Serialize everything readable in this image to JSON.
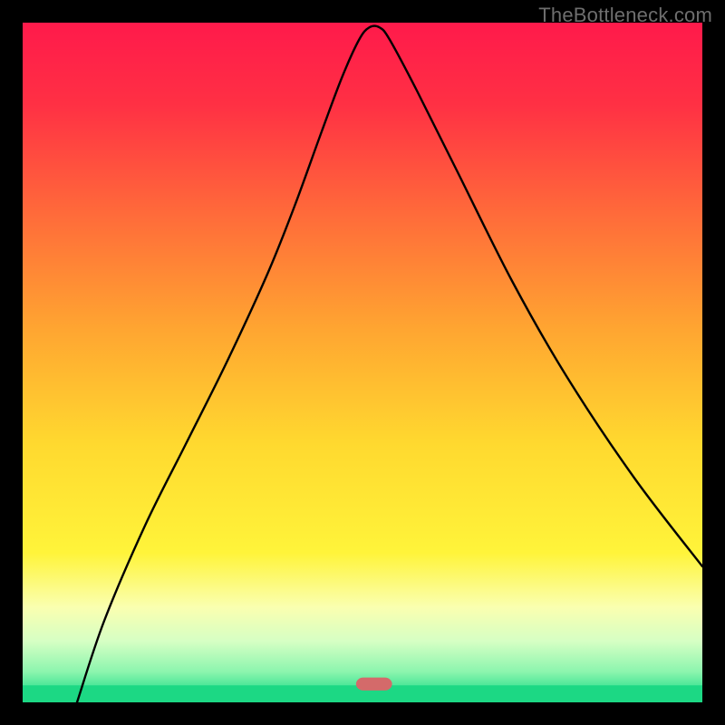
{
  "watermark": "TheBottleneck.com",
  "chart_data": {
    "type": "line",
    "title": "",
    "xlabel": "",
    "ylabel": "",
    "xlim": [
      0,
      100
    ],
    "ylim": [
      0,
      100
    ],
    "background_gradient_stops": [
      {
        "offset": 0.0,
        "color": "#ff1a4b"
      },
      {
        "offset": 0.12,
        "color": "#ff3044"
      },
      {
        "offset": 0.28,
        "color": "#ff6a3a"
      },
      {
        "offset": 0.45,
        "color": "#ffa531"
      },
      {
        "offset": 0.62,
        "color": "#ffd92f"
      },
      {
        "offset": 0.78,
        "color": "#fff43a"
      },
      {
        "offset": 0.86,
        "color": "#faffb0"
      },
      {
        "offset": 0.91,
        "color": "#d6ffc4"
      },
      {
        "offset": 0.955,
        "color": "#8cf5ae"
      },
      {
        "offset": 0.985,
        "color": "#2fe08e"
      },
      {
        "offset": 1.0,
        "color": "#1cd884"
      }
    ],
    "green_baseline_y": 97.5,
    "series": [
      {
        "name": "bottleneck-curve",
        "x": [
          8,
          12,
          18,
          24,
          30,
          36,
          40,
          44,
          47,
          49.5,
          51,
          52.5,
          54,
          58,
          64,
          72,
          80,
          90,
          100
        ],
        "y": [
          100,
          88,
          74,
          62,
          50,
          37,
          27,
          16,
          8,
          2.5,
          0.7,
          0.7,
          2.5,
          10,
          22,
          38,
          52,
          67,
          80
        ]
      }
    ],
    "minimum_marker": {
      "x_center": 51.7,
      "y": 97.3,
      "width": 5.3,
      "height": 1.9,
      "color": "#d46a6a",
      "rx": 8
    }
  }
}
